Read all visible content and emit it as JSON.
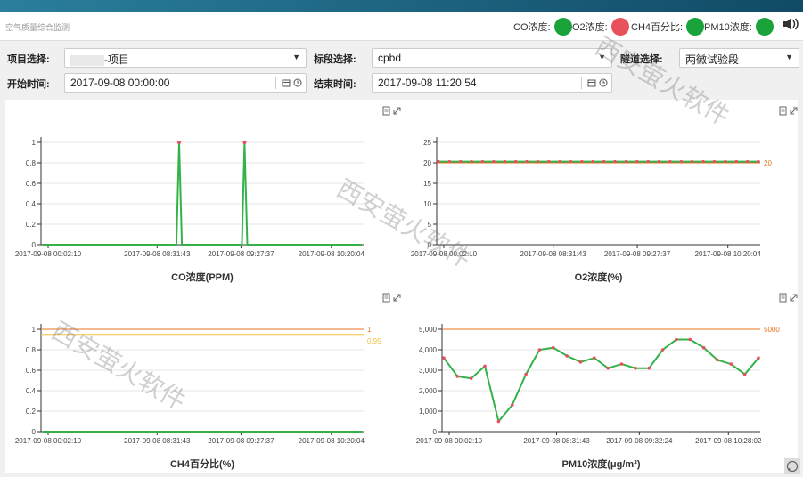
{
  "header": {
    "title": "空气质量综合监测",
    "indicators": [
      {
        "label": "CO浓度:",
        "color": "#1aa33a"
      },
      {
        "label": "O2浓度:",
        "color": "#e8505b"
      },
      {
        "label": "CH4百分比:",
        "color": "#1aa33a"
      },
      {
        "label": "PM10浓度:",
        "color": "#1aa33a"
      }
    ]
  },
  "filters": {
    "project_label": "项目选择:",
    "project_value": "-项目",
    "section_label": "标段选择:",
    "section_value": "cpbd",
    "tunnel_label": "隧道选择:",
    "tunnel_value": "两徽试验段",
    "start_label": "开始时间:",
    "start_value": "2017-09-08 00:00:00",
    "end_label": "结束时间:",
    "end_value": "2017-09-08 11:20:54"
  },
  "watermark": "西安萤火软件",
  "chart_data": [
    {
      "type": "line",
      "title": "CO浓度(PPM)",
      "x_tick_labels": [
        "2017-09-08 00:02:10",
        "2017-09-08 08:31:43",
        "2017-09-08 09:27:37",
        "2017-09-08 10:20:04"
      ],
      "y_ticks": [
        "0",
        "0.2",
        "0.4",
        "0.6",
        "0.8",
        "1"
      ],
      "ylim": [
        0,
        1
      ],
      "series": [
        {
          "values": [
            0,
            0,
            0,
            0,
            0,
            0,
            0,
            0,
            0,
            0,
            0,
            0,
            0,
            0,
            0,
            0,
            0,
            0,
            0,
            0,
            0,
            0,
            0,
            0,
            0,
            0,
            0,
            0,
            0,
            0,
            0,
            0,
            0,
            0,
            0,
            0,
            0,
            0,
            0,
            0,
            0,
            0,
            0,
            0,
            0,
            0,
            0,
            0,
            0,
            0,
            1,
            0,
            0,
            0,
            0,
            0,
            0,
            0,
            0,
            0,
            0,
            0,
            0,
            0,
            0,
            0,
            0,
            0,
            0,
            0,
            0,
            0,
            0,
            0,
            1,
            0,
            0,
            0,
            0,
            0,
            0,
            0,
            0,
            0,
            0,
            0,
            0,
            0,
            0,
            0,
            0,
            0,
            0,
            0,
            0,
            0,
            0,
            0,
            0,
            0,
            0,
            0,
            0,
            0,
            0,
            0,
            0,
            0,
            0,
            0,
            0,
            0,
            0,
            0,
            0,
            0,
            0,
            0
          ]
        }
      ],
      "line_color": "#34b24a"
    },
    {
      "type": "line",
      "title": "O2浓度(%)",
      "x_tick_labels": [
        "2017-09-08 00:02:10",
        "2017-09-08 08:31:43",
        "2017-09-08 09:27:37",
        "2017-09-08 10:20:04"
      ],
      "y_ticks": [
        "0",
        "5",
        "10",
        "15",
        "20",
        "25"
      ],
      "ylim": [
        0,
        25
      ],
      "series": [
        {
          "values": [
            20.3,
            20.3,
            20.3,
            20.3,
            20.3,
            20.3,
            20.3,
            20.3,
            20.3,
            20.3,
            20.3,
            20.3,
            20.3,
            20.3,
            20.3,
            20.3,
            20.3,
            20.3,
            20.3,
            20.3,
            20.3,
            20.3,
            20.3,
            20.3,
            20.3,
            20.3,
            20.3,
            20.3,
            20.3,
            20.3
          ]
        }
      ],
      "threshold": {
        "value": 20,
        "label": "20",
        "color": "#e8731f"
      },
      "line_color": "#34b24a"
    },
    {
      "type": "line",
      "title": "CH4百分比(%)",
      "x_tick_labels": [
        "2017-09-08 00:02:10",
        "2017-09-08 08:31:43",
        "2017-09-08 09:27:37",
        "2017-09-08 10:20:04"
      ],
      "y_ticks": [
        "0",
        "0.2",
        "0.4",
        "0.6",
        "0.8",
        "1"
      ],
      "ylim": [
        0,
        1
      ],
      "series": [
        {
          "values": [
            0,
            0,
            0,
            0,
            0,
            0,
            0,
            0,
            0,
            0,
            0,
            0,
            0,
            0,
            0,
            0,
            0,
            0,
            0,
            0
          ]
        }
      ],
      "threshold": {
        "value": 1,
        "label": "1",
        "color": "#e8731f"
      },
      "threshold2": {
        "value": 0.95,
        "label": "0.95",
        "color": "#f0c040"
      },
      "line_color": "#34b24a"
    },
    {
      "type": "line",
      "title": "PM10浓度(μg/m³)",
      "x_tick_labels": [
        "2017-09-08 00:02:10",
        "2017-09-08 08:31:43",
        "2017-09-08 09:32:24",
        "2017-09-08 10:28:02"
      ],
      "y_ticks": [
        "0",
        "1,000",
        "2,000",
        "3,000",
        "4,000",
        "5,000"
      ],
      "ylim": [
        0,
        5000
      ],
      "series": [
        {
          "values": [
            3600,
            2700,
            2600,
            3200,
            500,
            1300,
            2800,
            4000,
            4100,
            3700,
            3400,
            3600,
            3100,
            3300,
            3100,
            3100,
            4000,
            4500,
            4500,
            4100,
            3500,
            3300,
            2800,
            3600
          ]
        }
      ],
      "threshold": {
        "value": 5000,
        "label": "5000",
        "color": "#e8731f"
      },
      "line_color": "#34b24a"
    }
  ]
}
